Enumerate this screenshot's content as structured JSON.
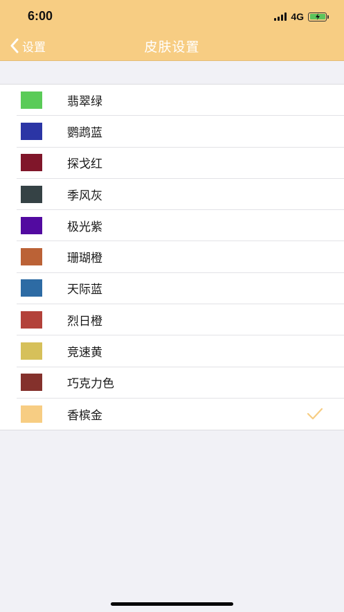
{
  "status_bar": {
    "time": "6:00",
    "network": "4G",
    "battery_color": "#5cc45c"
  },
  "nav": {
    "back_label": "设置",
    "title": "皮肤设置",
    "header_color": "#f7cd83"
  },
  "skins": [
    {
      "name": "翡翠绿",
      "color": "#5acb58",
      "selected": false
    },
    {
      "name": "鹦鹉蓝",
      "color": "#2b35a5",
      "selected": false
    },
    {
      "name": "探戈红",
      "color": "#80162a",
      "selected": false
    },
    {
      "name": "季风灰",
      "color": "#354245",
      "selected": false
    },
    {
      "name": "极光紫",
      "color": "#520aa0",
      "selected": false
    },
    {
      "name": "珊瑚橙",
      "color": "#bb6236",
      "selected": false
    },
    {
      "name": "天际蓝",
      "color": "#2d6ba4",
      "selected": false
    },
    {
      "name": "烈日橙",
      "color": "#b3423a",
      "selected": false
    },
    {
      "name": "竞速黄",
      "color": "#d6c05a",
      "selected": false
    },
    {
      "name": "巧克力色",
      "color": "#84312c",
      "selected": false
    },
    {
      "name": "香槟金",
      "color": "#f7cd83",
      "selected": true
    }
  ],
  "check_color": "#f7cd83"
}
